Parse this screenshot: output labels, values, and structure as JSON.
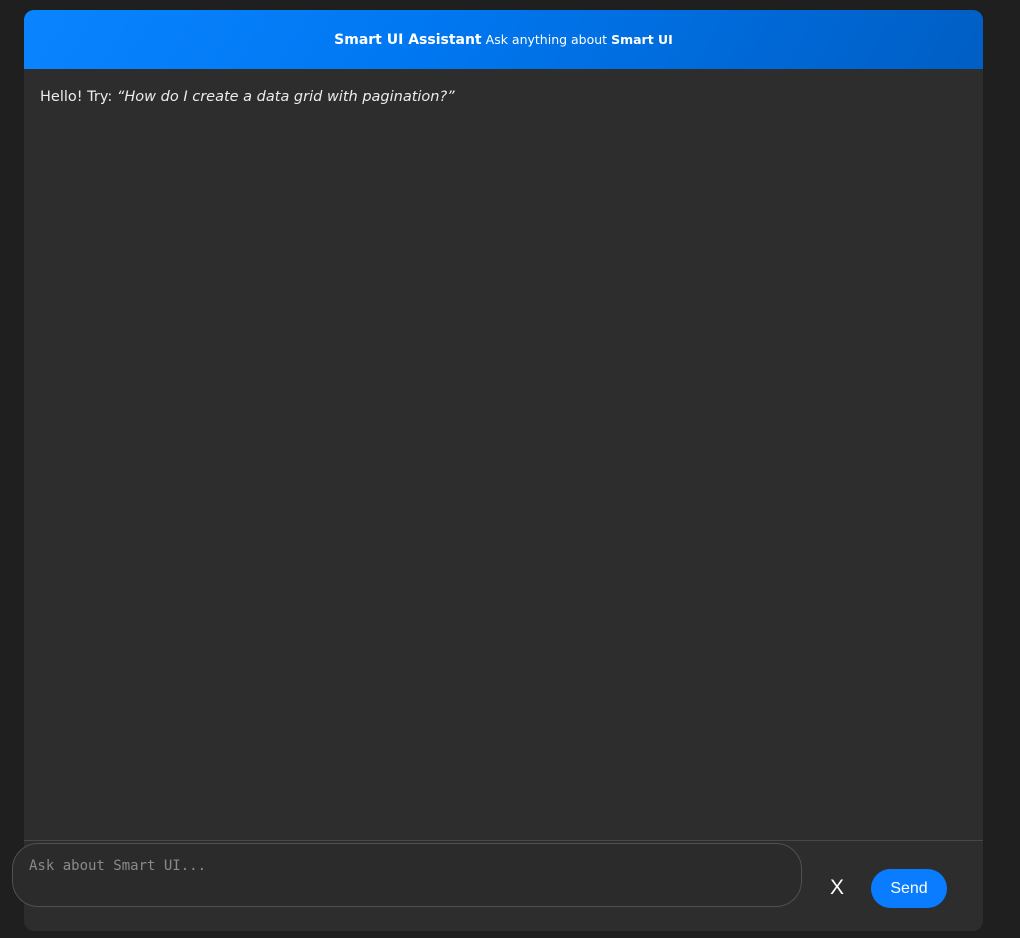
{
  "header": {
    "title": "Smart UI Assistant",
    "subtitle_prefix": "Ask anything about ",
    "subtitle_bold": "Smart UI",
    "accent_color": "#0a84ff"
  },
  "messages": [
    {
      "greeting": "Hello! Try: ",
      "suggestion": "“How do I create a data grid with pagination?”"
    }
  ],
  "composer": {
    "value": "",
    "placeholder": "Ask about Smart UI..."
  },
  "actions": {
    "clear_label": "X",
    "send_label": "Send",
    "send_color": "#0a7cff"
  }
}
